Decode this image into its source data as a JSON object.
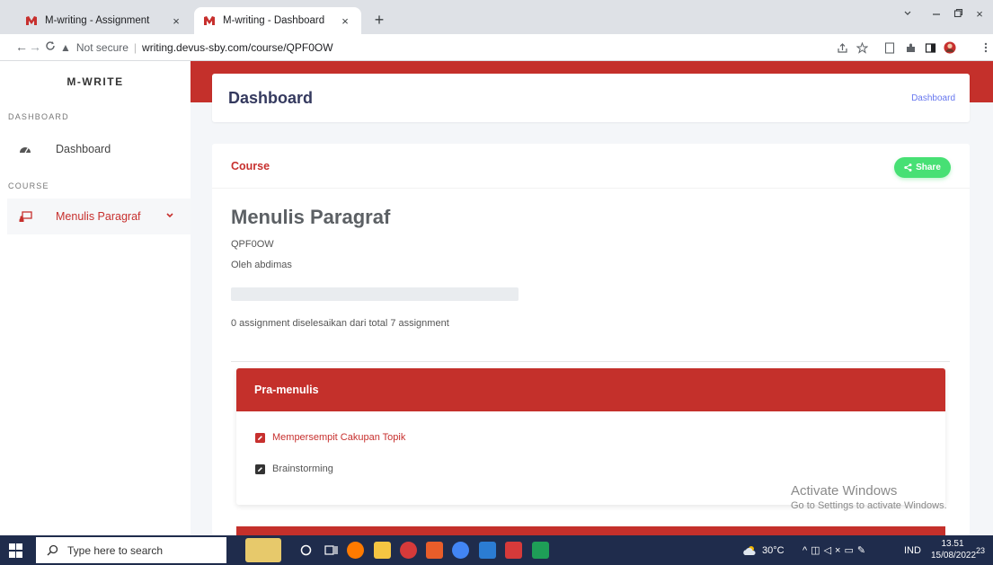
{
  "browser": {
    "tabs": [
      {
        "title": "M-writing - Assignment",
        "active": false
      },
      {
        "title": "M-writing - Dashboard",
        "active": true
      }
    ],
    "security_label": "Not secure",
    "url": "writing.devus-sby.com/course/QPF0OW"
  },
  "sidebar": {
    "brand": "M-WRITE",
    "section_dashboard": "DASHBOARD",
    "item_dashboard": "Dashboard",
    "section_course": "COURSE",
    "item_course": "Menulis Paragraf"
  },
  "header": {
    "title": "Dashboard",
    "breadcrumb": "Dashboard"
  },
  "course": {
    "label": "Course",
    "share_label": "Share",
    "title": "Menulis Paragraf",
    "code": "QPF0OW",
    "author": "Oleh abdimas",
    "progress_percent": 0,
    "progress_text": "0 assignment diselesaikan dari total 7 assignment",
    "sections": [
      {
        "title": "Pra-menulis",
        "assignments": [
          "Mempersempit Cakupan Topik",
          "Brainstorming"
        ]
      }
    ]
  },
  "watermark": {
    "line1": "Activate Windows",
    "line2": "Go to Settings to activate Windows."
  },
  "taskbar": {
    "search_placeholder": "Type here to search",
    "weather": "30°C",
    "language": "IND",
    "time": "13.51",
    "date": "15/08/2022",
    "notification_count": "23"
  },
  "colors": {
    "brand_red": "#c4302b",
    "share_green": "#47e074",
    "link_blue": "#6777ef"
  }
}
